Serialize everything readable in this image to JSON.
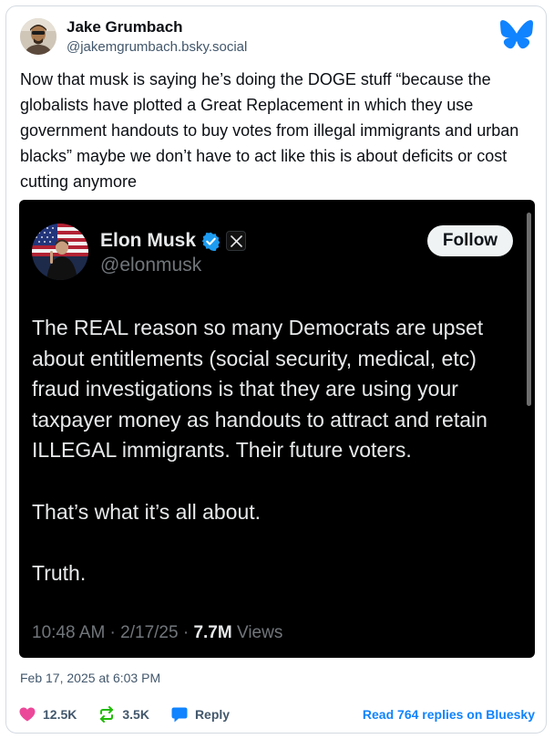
{
  "post": {
    "author_name": "Jake Grumbach",
    "author_handle": "@jakemgrumbach.bsky.social",
    "text": "Now that musk is saying he’s doing the DOGE stuff “because the globalists have plotted a Great Replacement in which they use government handouts to buy votes from illegal immigrants and urban blacks” maybe we don’t have to act like this is about deficits or cost cutting anymore",
    "date": "Feb 17, 2025 at 6:03 PM"
  },
  "embed": {
    "name": "Elon Musk",
    "handle": "@elonmusk",
    "follow_label": "Follow",
    "paragraphs": [
      "The REAL reason so many Democrats are upset about entitlements (social security, medical, etc) fraud investigations is that they are using your taxpayer money as handouts to attract and retain ILLEGAL immigrants. Their future voters.",
      "That’s what it’s all about.",
      "Truth."
    ],
    "time": "10:48 AM · 2/17/25 ·",
    "views_count": "7.7M",
    "views_label": "Views"
  },
  "footer": {
    "likes": "12.5K",
    "reposts": "3.5K",
    "reply_label": "Reply",
    "read_replies": "Read 764 replies on Bluesky"
  },
  "icons": {
    "like": "heart-icon",
    "repost": "repost-icon",
    "reply": "reply-bubble-icon",
    "brand": "bluesky-butterfly-icon",
    "verified": "verified-badge-icon",
    "x": "x-logo-icon"
  },
  "colors": {
    "bluesky_blue": "#1083fe",
    "like_pink": "#ec4899",
    "repost_green": "#20bc07",
    "verified_blue": "#1d9bf0",
    "embed_bg": "#000000"
  }
}
